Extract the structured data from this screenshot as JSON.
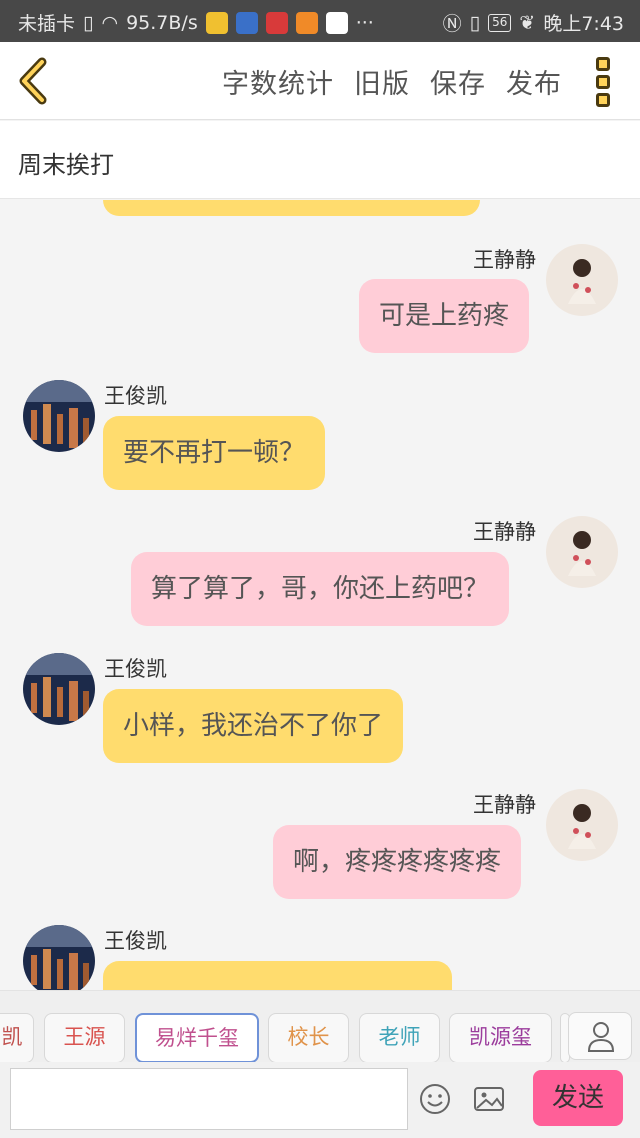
{
  "status_bar": {
    "carrier": "未插卡",
    "speed": "95.7B/s",
    "battery": "56",
    "time": "晚上7:43"
  },
  "toolbar": {
    "word_count": "字数统计",
    "old_version": "旧版",
    "save": "保存",
    "publish": "发布"
  },
  "story": {
    "title": "周末挨打"
  },
  "messages": [
    {
      "speaker": "王静静",
      "side": "right",
      "text": "可是上药疼"
    },
    {
      "speaker": "王俊凯",
      "side": "left",
      "text": "要不再打一顿？"
    },
    {
      "speaker": "王静静",
      "side": "right",
      "text": "算了算了，哥，你还上药吧？"
    },
    {
      "speaker": "王俊凯",
      "side": "left",
      "text": "小样，我还治不了你了"
    },
    {
      "speaker": "王静静",
      "side": "right",
      "text": "啊，疼疼疼疼疼疼"
    },
    {
      "speaker": "王俊凯",
      "side": "left",
      "text": ""
    }
  ],
  "roles": {
    "items": [
      "凯",
      "王源",
      "易烊千玺",
      "校长",
      "老师",
      "凯源玺"
    ],
    "selected": "易烊千玺",
    "colors": [
      "#c0504d",
      "#d9534f",
      "#c0508e",
      "#e0934a",
      "#3fa3b8",
      "#9b3c9c"
    ]
  },
  "composer": {
    "placeholder": "",
    "value": "",
    "send": "发送"
  },
  "colors": {
    "left_bubble": "#ffdc6e",
    "right_bubble": "#ffcdd7",
    "send_button": "#ff5f98",
    "accent_icon": "#ffd35a"
  },
  "icons": [
    "back-chevron-icon",
    "more-icon",
    "person-icon",
    "emoji-icon",
    "image-icon"
  ]
}
